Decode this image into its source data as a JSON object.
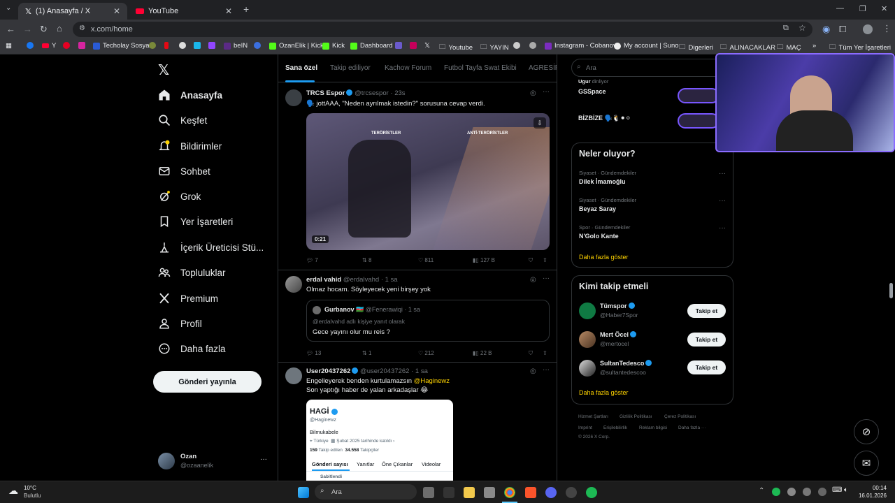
{
  "browser": {
    "tabs": [
      {
        "title": "(1) Anasayfa / X",
        "active": true
      },
      {
        "title": "YouTube",
        "active": false
      }
    ],
    "new_tab_label": "+",
    "url": "x.com/home",
    "bookmarks": [
      "Y",
      "Techolay Sosyal",
      "beIN",
      "OzanElik | Kick",
      "Kick",
      "Dashboard",
      "Youtube",
      "YAYIN",
      "Instagram - Cobanov",
      "My account | Suno",
      "Digerleri",
      "ALINACAKLAR",
      "MAÇ"
    ],
    "bookmarks_more": "»",
    "all_bookmarks": "Tüm Yer İşaretleri"
  },
  "sidebar": {
    "items": [
      {
        "label": "Anasayfa",
        "icon": "home-icon"
      },
      {
        "label": "Keşfet",
        "icon": "search-icon"
      },
      {
        "label": "Bildirimler",
        "icon": "bell-icon"
      },
      {
        "label": "Sohbet",
        "icon": "mail-icon"
      },
      {
        "label": "Grok",
        "icon": "grok-icon"
      },
      {
        "label": "Yer İşaretleri",
        "icon": "bookmark-icon"
      },
      {
        "label": "İçerik Üreticisi Stü...",
        "icon": "creator-icon"
      },
      {
        "label": "Topluluklar",
        "icon": "communities-icon"
      },
      {
        "label": "Premium",
        "icon": "x-logo-icon"
      },
      {
        "label": "Profil",
        "icon": "profile-icon"
      },
      {
        "label": "Daha fazla",
        "icon": "more-circle-icon"
      }
    ],
    "post_button": "Gönderi yayınla",
    "account": {
      "name": "Ozan",
      "handle": "@ozaanelik",
      "menu": "···"
    }
  },
  "timeline": {
    "tabs": [
      "Sana özel",
      "Takip ediliyor",
      "Kachow Forum",
      "Futbol Tayfa Swat Ekibi",
      "AGRESİF"
    ],
    "posts": [
      {
        "name": "TRCS Espor",
        "handle": "@trcsespor",
        "time": "· 23s",
        "text": "🗣️ jottAAA, \"Neden ayrılmak istedin?\" sorusuna cevap verdi.",
        "media": {
          "duration": "0:21",
          "left_team": "TERÖRİSTLER",
          "right_team": "ANTİ-TERÖRİSTLER"
        },
        "stats": {
          "replies": "7",
          "reposts": "8",
          "likes": "811",
          "views": "127 B"
        }
      },
      {
        "name": "erdal vahid",
        "handle": "@erdalvahd",
        "time": "· 1 sa",
        "text": "Olmaz hocam.  Söyleyecek yeni birşey yok",
        "quote": {
          "name": "Gurbanov 🇦🇿",
          "handle": "@Fenerawiqi",
          "time": "· 1 sa",
          "reply_to": "@erdalvahd adlı kişiye yanıt olarak",
          "text": "Gece yayını olur mu reis ?"
        },
        "stats": {
          "replies": "13",
          "reposts": "1",
          "likes": "212",
          "views": "22 B"
        }
      },
      {
        "name": "User20437262",
        "handle": "@user20437262",
        "time": "· 1 sa",
        "text_line1": "Engelleyerek benden kurtulamazsın",
        "mention": "@Haginewz",
        "text_line2": "Son yaptığı haber de yalan arkadaşlar 😂",
        "profile_card": {
          "name": "HAGİ",
          "handle": "@Haginewz",
          "bio": "Bilmukabele",
          "location": "Türkiye",
          "joined": "Şubat 2025 tarihinde katıldı",
          "following_count": "159",
          "following_label": "Takip edilen",
          "followers_count": "34.558",
          "followers_label": "Takipçiler",
          "tabs": [
            "Gönderi sayısı",
            "Yanıtlar",
            "Öne Çıkanlar",
            "Videolar"
          ],
          "pinned": "Sabitlendi"
        }
      }
    ]
  },
  "right": {
    "search_placeholder": "Ara",
    "spaces": [
      {
        "host": "Ugur",
        "host_status": "dinliyor",
        "title": "GSSpace"
      },
      {
        "title": "BİZBİZE 🗣️🐧⚫⚪"
      }
    ],
    "trends_title": "Neler oluyor?",
    "trends": [
      {
        "category": "Siyaset · Gündemdekiler",
        "name": "Dilek İmamoğlu"
      },
      {
        "category": "Siyaset · Gündemdekiler",
        "name": "Beyaz Saray"
      },
      {
        "category": "Spor · Gündemdekiler",
        "name": "N'Golo Kante"
      }
    ],
    "show_more": "Daha fazla göster",
    "who_to_follow_title": "Kimi takip etmeli",
    "suggestions": [
      {
        "name": "Tümspor",
        "handle": "@Haber7Spor",
        "button": "Takip et"
      },
      {
        "name": "Mert Öcel",
        "handle": "@mertocel",
        "button": "Takip et"
      },
      {
        "name": "SultanTedesco",
        "handle": "@sultantedescoo",
        "button": "Takip et"
      }
    ],
    "footer": [
      "Hizmet Şartları",
      "Gizlilik Politikası",
      "Çerez Politikası",
      "Imprint",
      "Erişilebilirlik",
      "Reklam bilgisi",
      "Daha fazla ···",
      "© 2026 X Corp."
    ]
  },
  "taskbar": {
    "weather_temp": "10°C",
    "weather_desc": "Bulutlu",
    "search_placeholder": "Ara",
    "time": "00:14",
    "date": "16.01.2026"
  },
  "colors": {
    "accent": "#1d9bf0",
    "link": "#ffd400",
    "background": "#000000",
    "border": "#2f3336"
  }
}
